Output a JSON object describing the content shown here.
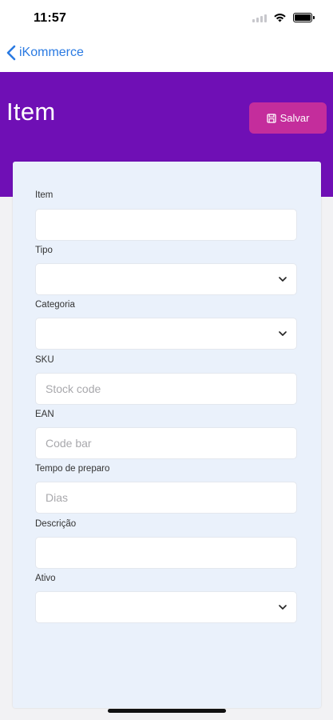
{
  "status_bar": {
    "time": "11:57"
  },
  "nav": {
    "back_label": "iKommerce"
  },
  "header": {
    "title": "Item",
    "save_label": "Salvar",
    "color": "#6f0fb5",
    "save_color": "#c42d9c"
  },
  "form": {
    "fields": [
      {
        "label": "Item",
        "type": "text",
        "value": "",
        "placeholder": ""
      },
      {
        "label": "Tipo",
        "type": "select",
        "value": ""
      },
      {
        "label": "Categoria",
        "type": "select",
        "value": ""
      },
      {
        "label": "SKU",
        "type": "text",
        "value": "",
        "placeholder": "Stock code"
      },
      {
        "label": "EAN",
        "type": "text",
        "value": "",
        "placeholder": "Code bar"
      },
      {
        "label": "Tempo de preparo",
        "type": "text",
        "value": "",
        "placeholder": "Dias"
      },
      {
        "label": "Descrição",
        "type": "text",
        "value": "",
        "placeholder": ""
      },
      {
        "label": "Ativo",
        "type": "select",
        "value": ""
      }
    ]
  }
}
